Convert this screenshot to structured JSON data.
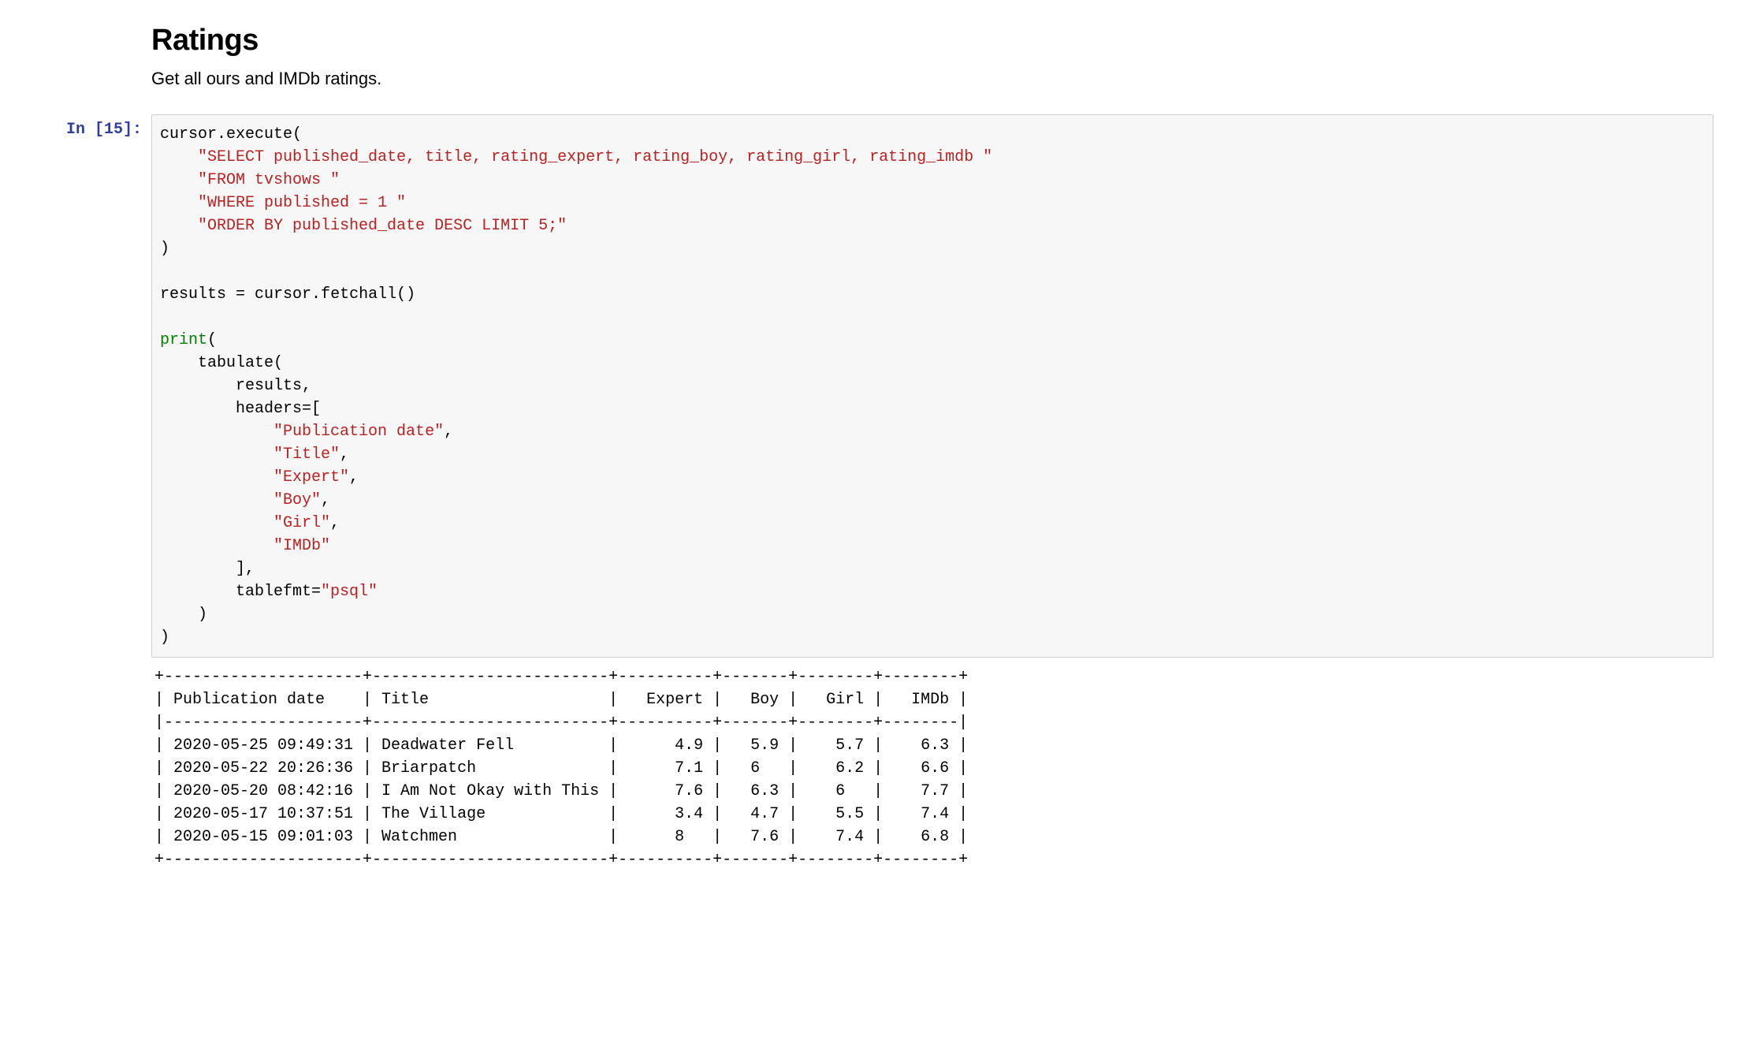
{
  "heading": "Ratings",
  "description": "Get all ours and IMDb ratings.",
  "prompt_label": "In [15]:",
  "code": {
    "line1_a": "cursor",
    "line1_b": ".",
    "line1_c": "execute",
    "line1_d": "(",
    "line2_str": "\"SELECT published_date, title, rating_expert, rating_boy, rating_girl, rating_imdb \"",
    "line3_str": "\"FROM tvshows \"",
    "line4_str": "\"WHERE published = 1 \"",
    "line5_str": "\"ORDER BY published_date DESC LIMIT 5;\"",
    "line6": ")",
    "line7": "",
    "line8_a": "results ",
    "line8_b": "=",
    "line8_c": " cursor",
    "line8_d": ".",
    "line8_e": "fetchall()",
    "line9": "",
    "line10_a": "print",
    "line10_b": "(",
    "line11_a": "    tabulate(",
    "line12_a": "        results,",
    "line13_a": "        headers",
    "line13_b": "=",
    "line13_c": "[",
    "line14_str": "\"Publication date\"",
    "line15_str": "\"Title\"",
    "line16_str": "\"Expert\"",
    "line17_str": "\"Boy\"",
    "line18_str": "\"Girl\"",
    "line19_str": "\"IMDb\"",
    "line20": "        ],",
    "line21_a": "        tablefmt",
    "line21_b": "=",
    "line21_str": "\"psql\"",
    "line22": "    )",
    "line23": ")",
    "comma": ","
  },
  "output_lines": [
    "+---------------------+-------------------------+----------+-------+--------+--------+",
    "| Publication date    | Title                   |   Expert |   Boy |   Girl |   IMDb |",
    "|---------------------+-------------------------+----------+-------+--------+--------|",
    "| 2020-05-25 09:49:31 | Deadwater Fell          |      4.9 |   5.9 |    5.7 |    6.3 |",
    "| 2020-05-22 20:26:36 | Briarpatch              |      7.1 |   6   |    6.2 |    6.6 |",
    "| 2020-05-20 08:42:16 | I Am Not Okay with This |      7.6 |   6.3 |    6   |    7.7 |",
    "| 2020-05-17 10:37:51 | The Village             |      3.4 |   4.7 |    5.5 |    7.4 |",
    "| 2020-05-15 09:01:03 | Watchmen                |      8   |   7.6 |    7.4 |    6.8 |",
    "+---------------------+-------------------------+----------+-------+--------+--------+"
  ]
}
